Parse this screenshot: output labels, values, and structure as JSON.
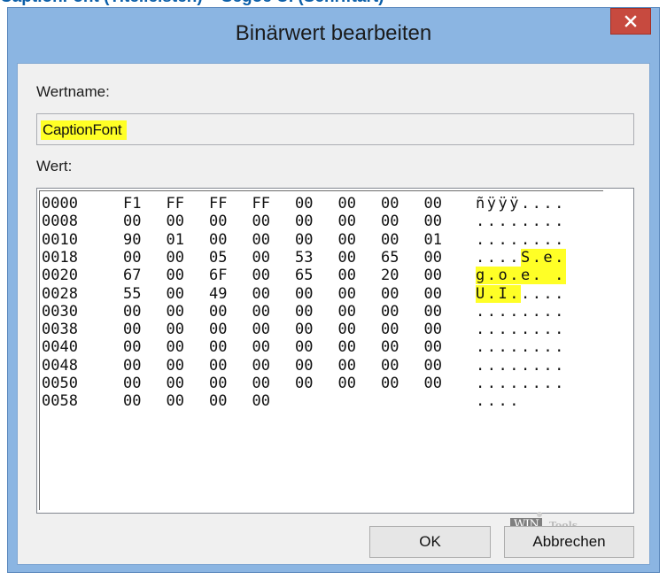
{
  "heading": "CaptionFont (Titelleisten) – Segoe UI (Schriftart)",
  "dialog": {
    "title": "Binärwert bearbeiten",
    "close_glyph": "✕",
    "name_label": "Wertname:",
    "name_value": "CaptionFont",
    "value_label": "Wert:",
    "ok_label": "OK",
    "cancel_label": "Abbrechen",
    "watermark_win": "WIN",
    "watermark_tool": "Tools"
  },
  "hex_rows": [
    {
      "addr": "0000",
      "bytes": [
        "F1",
        "FF",
        "FF",
        "FF",
        "00",
        "00",
        "00",
        "00"
      ],
      "ascii": [
        {
          "t": "ñÿÿÿ....",
          "hl": false
        }
      ]
    },
    {
      "addr": "0008",
      "bytes": [
        "00",
        "00",
        "00",
        "00",
        "00",
        "00",
        "00",
        "00"
      ],
      "ascii": [
        {
          "t": "........",
          "hl": false
        }
      ]
    },
    {
      "addr": "0010",
      "bytes": [
        "90",
        "01",
        "00",
        "00",
        "00",
        "00",
        "00",
        "01"
      ],
      "ascii": [
        {
          "t": "........",
          "hl": false
        }
      ]
    },
    {
      "addr": "0018",
      "bytes": [
        "00",
        "00",
        "05",
        "00",
        "53",
        "00",
        "65",
        "00"
      ],
      "ascii": [
        {
          "t": "....",
          "hl": false
        },
        {
          "t": "S.e.",
          "hl": true
        }
      ]
    },
    {
      "addr": "0020",
      "bytes": [
        "67",
        "00",
        "6F",
        "00",
        "65",
        "00",
        "20",
        "00"
      ],
      "ascii": [
        {
          "t": "g.o.e. .",
          "hl": true
        }
      ]
    },
    {
      "addr": "0028",
      "bytes": [
        "55",
        "00",
        "49",
        "00",
        "00",
        "00",
        "00",
        "00"
      ],
      "ascii": [
        {
          "t": "U.I.",
          "hl": true
        },
        {
          "t": "....",
          "hl": false
        }
      ]
    },
    {
      "addr": "0030",
      "bytes": [
        "00",
        "00",
        "00",
        "00",
        "00",
        "00",
        "00",
        "00"
      ],
      "ascii": [
        {
          "t": "........",
          "hl": false
        }
      ]
    },
    {
      "addr": "0038",
      "bytes": [
        "00",
        "00",
        "00",
        "00",
        "00",
        "00",
        "00",
        "00"
      ],
      "ascii": [
        {
          "t": "........",
          "hl": false
        }
      ]
    },
    {
      "addr": "0040",
      "bytes": [
        "00",
        "00",
        "00",
        "00",
        "00",
        "00",
        "00",
        "00"
      ],
      "ascii": [
        {
          "t": "........",
          "hl": false
        }
      ]
    },
    {
      "addr": "0048",
      "bytes": [
        "00",
        "00",
        "00",
        "00",
        "00",
        "00",
        "00",
        "00"
      ],
      "ascii": [
        {
          "t": "........",
          "hl": false
        }
      ]
    },
    {
      "addr": "0050",
      "bytes": [
        "00",
        "00",
        "00",
        "00",
        "00",
        "00",
        "00",
        "00"
      ],
      "ascii": [
        {
          "t": "........",
          "hl": false
        }
      ]
    },
    {
      "addr": "0058",
      "bytes": [
        "00",
        "00",
        "00",
        "00"
      ],
      "ascii": [
        {
          "t": "....",
          "hl": false
        }
      ]
    }
  ],
  "colors": {
    "highlight": "#ffff26",
    "title_bar": "#8bb5e2",
    "close_button": "#c74a3f",
    "heading": "#0b5ea8"
  }
}
